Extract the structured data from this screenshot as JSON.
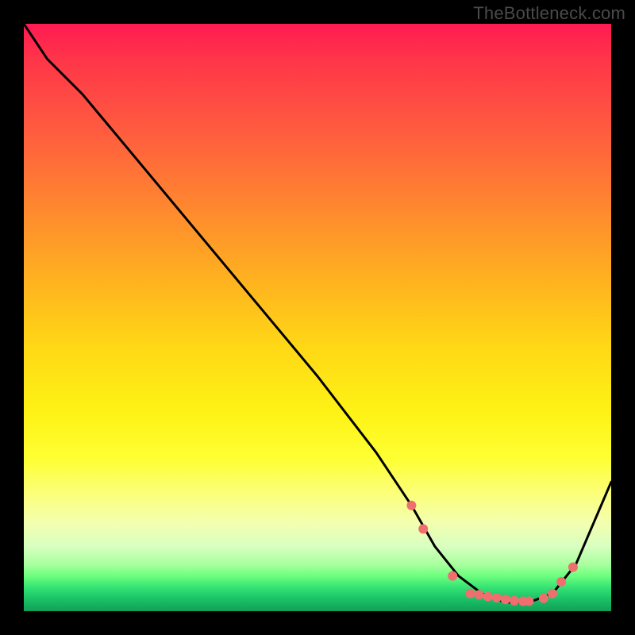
{
  "attribution": "TheBottleneck.com",
  "chart_data": {
    "type": "line",
    "title": "",
    "xlabel": "",
    "ylabel": "",
    "xlim": [
      0,
      100
    ],
    "ylim": [
      0,
      100
    ],
    "grid": false,
    "legend": false,
    "background": "red-yellow-green vertical gradient",
    "series": [
      {
        "name": "curve",
        "color": "#000000",
        "x": [
          0,
          4,
          10,
          20,
          30,
          40,
          50,
          60,
          66,
          70,
          74,
          78,
          82,
          86,
          90,
          94,
          100
        ],
        "y": [
          100,
          94,
          88,
          76,
          64,
          52,
          40,
          27,
          18,
          11,
          6,
          3,
          1.5,
          1.5,
          3,
          8,
          22
        ]
      }
    ],
    "markers": {
      "name": "highlight-points",
      "color": "#ef6f6f",
      "radius_px": 6,
      "x": [
        66,
        68,
        73,
        76,
        77.5,
        79,
        80.5,
        82,
        83.5,
        85,
        86,
        88.5,
        90,
        91.5,
        93.5
      ],
      "y": [
        18,
        14,
        6,
        3,
        2.8,
        2.5,
        2.3,
        2,
        1.8,
        1.7,
        1.7,
        2.2,
        3,
        5,
        7.5
      ]
    }
  }
}
